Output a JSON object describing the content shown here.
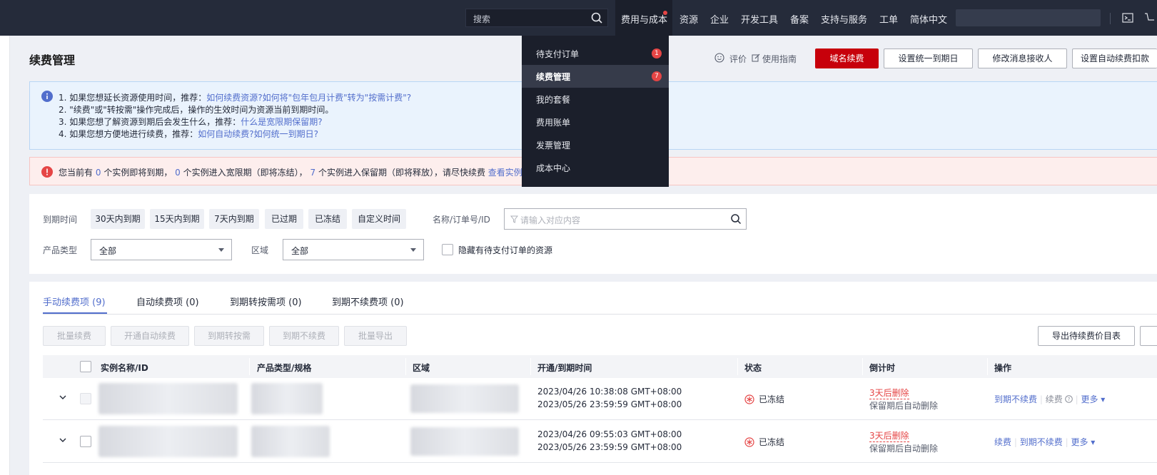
{
  "topbar": {
    "search_placeholder": "搜索",
    "nav": [
      "费用与成本",
      "资源",
      "企业",
      "开发工具",
      "备案",
      "支持与服务",
      "工单",
      "简体中文"
    ]
  },
  "dropdown": {
    "items": [
      {
        "label": "待支付订单",
        "badge": "1"
      },
      {
        "label": "续费管理",
        "badge": "7"
      },
      {
        "label": "我的套餐",
        "badge": ""
      },
      {
        "label": "费用账单",
        "badge": ""
      },
      {
        "label": "发票管理",
        "badge": ""
      },
      {
        "label": "成本中心",
        "badge": ""
      }
    ]
  },
  "header": {
    "title": "续费管理",
    "rate": "评价",
    "guide": "使用指南",
    "buttons": [
      "域名续费",
      "设置统一到期日",
      "修改消息接收人",
      "设置自动续费扣款"
    ]
  },
  "info": {
    "l1_text": "1. 如果您想延长资源使用时间，推荐：",
    "l1_link1": "如何续费资源?",
    "l1_link2": "如何将\"包年包月计费\"转为\"按需计费\"?",
    "l2_text": "2. \"续费\"或\"转按需\"操作完成后，操作的生效时间为资源当前到期时间。",
    "l3_text": "3. 如果您想了解资源到期后会发生什么，推荐：",
    "l3_link": "什么是宽限期保留期?",
    "l4_text": "4. 如果您想方便地进行续费，推荐：",
    "l4_link1": "如何自动续费?",
    "l4_link2": "如何统一到期日?"
  },
  "warning": {
    "p1": "您当前有",
    "n1": "0",
    "p2": "个实例即将到期，",
    "n2": "0",
    "p3": "个实例进入宽限期（即将冻结），",
    "n3": "7",
    "p4": "个实例进入保留期（即将释放），请尽快续费",
    "link": "查看实例"
  },
  "filters": {
    "expire_label": "到期时间",
    "chips": [
      "30天内到期",
      "15天内到期",
      "7天内到期",
      "已过期",
      "已冻结",
      "自定义时间"
    ],
    "name_label": "名称/订单号/ID",
    "search_placeholder": "请输入对应内容",
    "product_label": "产品类型",
    "product_value": "全部",
    "region_label": "区域",
    "region_value": "全部",
    "hide_label": "隐藏有待支付订单的资源"
  },
  "tabs": [
    "手动续费项 (9)",
    "自动续费项 (0)",
    "到期转按需项 (0)",
    "到期不续费项 (0)"
  ],
  "batch_buttons": [
    "批量续费",
    "开通自动续费",
    "到期转按需",
    "到期不续费",
    "批量导出"
  ],
  "export_button": "导出待续费价目表",
  "table": {
    "headers": [
      "实例名称/ID",
      "产品类型/规格",
      "区域",
      "开通/到期时间",
      "状态",
      "倒计时",
      "操作"
    ],
    "rows": [
      {
        "open_time": "2023/04/26 10:38:08 GMT+08:00",
        "expire_time": "2023/05/26 23:59:59 GMT+08:00",
        "status": "已冻结",
        "countdown": "3天后删除",
        "countdown_sub": "保留期后自动删除",
        "ops": [
          "到期不续费",
          "续费",
          "更多"
        ]
      },
      {
        "open_time": "2023/04/26 09:55:03 GMT+08:00",
        "expire_time": "2023/05/26 23:59:59 GMT+08:00",
        "status": "已冻结",
        "countdown": "3天后删除",
        "countdown_sub": "保留期后自动删除",
        "ops": [
          "续费",
          "到期不续费",
          "更多"
        ]
      }
    ]
  },
  "colors": {
    "brand_red": "#c7000b",
    "link_blue": "#526ecc",
    "topbar": "#252b3a",
    "alert_red": "#e54545"
  }
}
